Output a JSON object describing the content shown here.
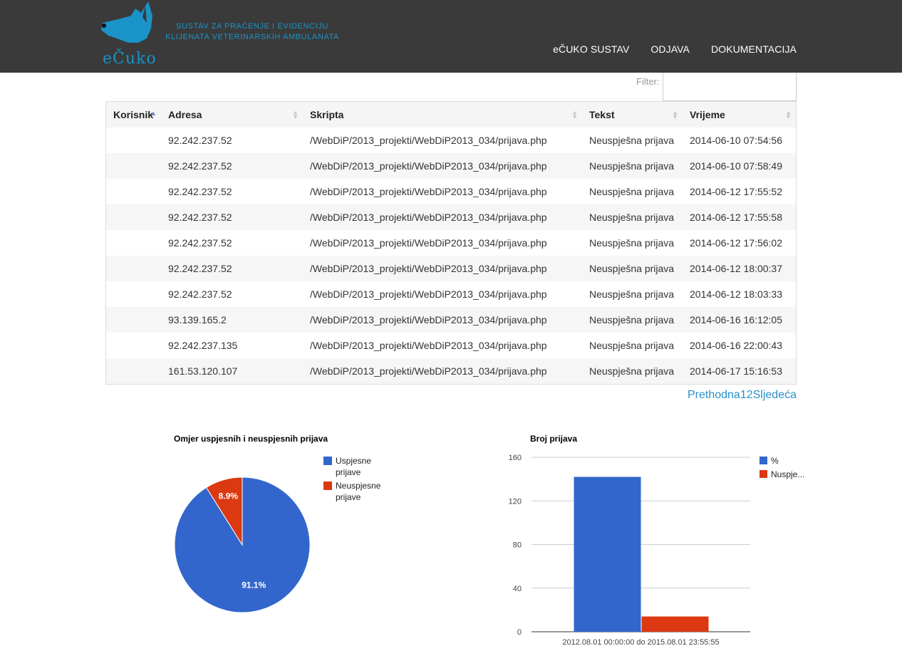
{
  "header": {
    "logo_text": "eČuko",
    "tagline": [
      "SUSTAV ZA PRAĆENJE I EVIDENCIJU",
      "KLIJENATA VETERINARSKIH AMBULANATA"
    ],
    "nav": [
      "eČUKO SUSTAV",
      "ODJAVA",
      "DOKUMENTACIJA"
    ]
  },
  "filter": {
    "label": "Filter:",
    "value": ""
  },
  "table": {
    "headers": [
      "Korisnik",
      "Adresa",
      "Skripta",
      "Tekst",
      "Vrijeme"
    ],
    "rows": [
      [
        "",
        "92.242.237.52",
        "/WebDiP/2013_projekti/WebDiP2013_034/prijava.php",
        "Neuspješna prijava",
        "2014-06-10 07:54:56"
      ],
      [
        "",
        "92.242.237.52",
        "/WebDiP/2013_projekti/WebDiP2013_034/prijava.php",
        "Neuspješna prijava",
        "2014-06-10 07:58:49"
      ],
      [
        "",
        "92.242.237.52",
        "/WebDiP/2013_projekti/WebDiP2013_034/prijava.php",
        "Neuspješna prijava",
        "2014-06-12 17:55:52"
      ],
      [
        "",
        "92.242.237.52",
        "/WebDiP/2013_projekti/WebDiP2013_034/prijava.php",
        "Neuspješna prijava",
        "2014-06-12 17:55:58"
      ],
      [
        "",
        "92.242.237.52",
        "/WebDiP/2013_projekti/WebDiP2013_034/prijava.php",
        "Neuspješna prijava",
        "2014-06-12 17:56:02"
      ],
      [
        "",
        "92.242.237.52",
        "/WebDiP/2013_projekti/WebDiP2013_034/prijava.php",
        "Neuspješna prijava",
        "2014-06-12 18:00:37"
      ],
      [
        "",
        "92.242.237.52",
        "/WebDiP/2013_projekti/WebDiP2013_034/prijava.php",
        "Neuspješna prijava",
        "2014-06-12 18:03:33"
      ],
      [
        "",
        "93.139.165.2",
        "/WebDiP/2013_projekti/WebDiP2013_034/prijava.php",
        "Neuspješna prijava",
        "2014-06-16 16:12:05"
      ],
      [
        "",
        "92.242.237.135",
        "/WebDiP/2013_projekti/WebDiP2013_034/prijava.php",
        "Neuspješna prijava",
        "2014-06-16 22:00:43"
      ],
      [
        "",
        "161.53.120.107",
        "/WebDiP/2013_projekti/WebDiP2013_034/prijava.php",
        "Neuspješna prijava",
        "2014-06-17 15:16:53"
      ]
    ]
  },
  "pagination": {
    "prev": "Prethodna",
    "pages": [
      "1",
      "2"
    ],
    "next": "Sljedeća"
  },
  "colors": {
    "blue": "#3366cc",
    "red": "#dc3912",
    "link": "#2a8fc7",
    "header_bg": "#3a3a3a",
    "brand": "#1a93c9"
  },
  "chart_data": [
    {
      "type": "pie",
      "title": "Omjer uspjesnih i neuspjesnih prijava",
      "legend_position": "right",
      "slices": [
        {
          "name": "Uspjesne prijave",
          "legend": [
            "Uspjesne",
            "prijave"
          ],
          "value": 91.1,
          "label": "91.1%",
          "color": "#3366cc"
        },
        {
          "name": "Neuspjesne prijave",
          "legend": [
            "Neuspjesne",
            "prijave"
          ],
          "value": 8.9,
          "label": "8.9%",
          "color": "#dc3912"
        }
      ]
    },
    {
      "type": "bar",
      "title": "Broj prijava",
      "categories": [
        "2012.08.01 00:00:00 do 2015.08.01 23:55:55"
      ],
      "series": [
        {
          "name": "%",
          "values": [
            142
          ],
          "color": "#3366cc"
        },
        {
          "name": "Nuspje...",
          "values": [
            14
          ],
          "color": "#dc3912"
        }
      ],
      "ylim": [
        0,
        160
      ],
      "yticks": [
        0,
        40,
        80,
        120,
        160
      ],
      "grid": true,
      "legend_position": "right"
    }
  ]
}
